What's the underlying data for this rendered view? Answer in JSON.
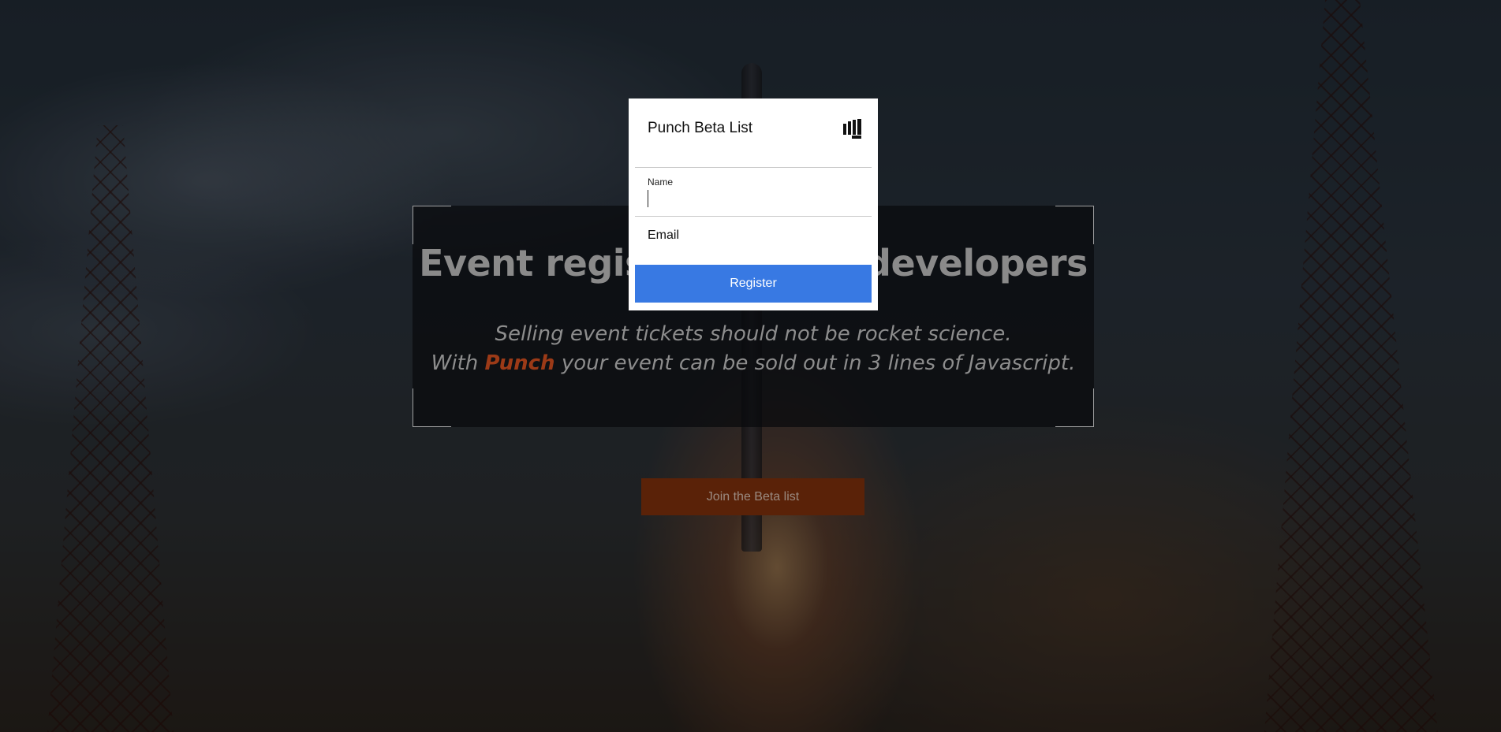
{
  "hero": {
    "title": "Event registration for developers",
    "subtitle_line1": "Selling event tickets should not be rocket science.",
    "subtitle_line2_before": "With ",
    "subtitle_line2_brand": "Punch",
    "subtitle_line2_after": " your event can be sold out in 3 lines of Javascript."
  },
  "cta": {
    "join_label": "Join the Beta list"
  },
  "modal": {
    "title": "Punch Beta List",
    "logo_icon": "punch-logo-icon",
    "name_label": "Name",
    "name_value": "",
    "email_placeholder": "Email",
    "email_value": "",
    "register_label": "Register"
  },
  "colors": {
    "register_button": "#3879e3",
    "join_button": "#5a2208",
    "brand_word": "#9c3a17"
  }
}
